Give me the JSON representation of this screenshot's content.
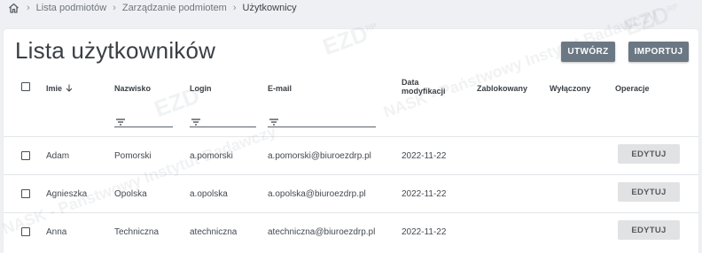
{
  "breadcrumb": {
    "items": [
      "Lista podmiotów",
      "Zarządzanie podmiotem",
      "Użytkownicy"
    ]
  },
  "page": {
    "title": "Lista użytkowników",
    "create_label": "UTWÓRZ",
    "import_label": "IMPORTUJ"
  },
  "table": {
    "headers": {
      "first_name": "Imie",
      "last_name": "Nazwisko",
      "login": "Login",
      "email": "E-mail",
      "modified_line1": "Data",
      "modified_line2": "modyfikacji",
      "blocked": "Zablokowany",
      "disabled": "Wyłączony",
      "operations": "Operacje"
    },
    "rows": [
      {
        "first_name": "Adam",
        "last_name": "Pomorski",
        "login": "a.pomorski",
        "email": "a.pomorski@biuroezdrp.pl",
        "modified": "2022-11-22",
        "edit_label": "EDYTUJ"
      },
      {
        "first_name": "Agnieszka",
        "last_name": "Opolska",
        "login": "a.opolska",
        "email": "a.opolska@biuroezdrp.pl",
        "modified": "2022-11-22",
        "edit_label": "EDYTUJ"
      },
      {
        "first_name": "Anna",
        "last_name": "Techniczna",
        "login": "atechniczna",
        "email": "atechniczna@biuroezdrp.pl",
        "modified": "2022-11-22",
        "edit_label": "EDYTUJ"
      }
    ]
  },
  "watermark": {
    "brand": "EZD",
    "brand_sub": "RP",
    "text": "NASK - Państwowy Instytut Badawczy"
  },
  "icons": {
    "home": "home-icon",
    "separator": "chevron-right-icon",
    "sort": "arrow-down-icon",
    "filter": "filter-icon"
  },
  "colors": {
    "primary_button": "#6b7884",
    "edit_button": "#e1e2e4",
    "background": "#eef0f3"
  }
}
